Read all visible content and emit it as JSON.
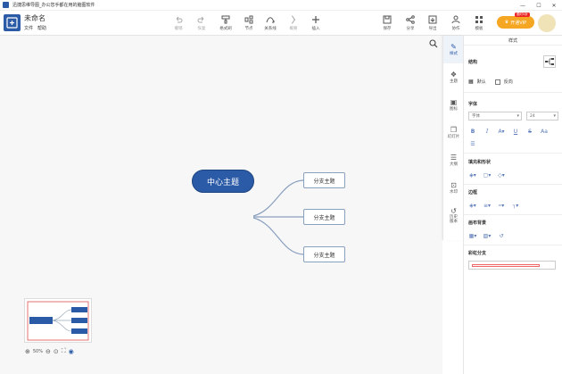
{
  "window": {
    "title": "迅捷思维导图_办公您手都在用的脑图软件",
    "controls": [
      "—",
      "☐",
      "✕"
    ]
  },
  "document": {
    "name": "未命名",
    "menu": [
      "文件",
      "帮助"
    ]
  },
  "toolbar": {
    "undo": "撤销",
    "redo": "恢复",
    "format_painter": "格式刷",
    "node": "节点",
    "relation": "关系线",
    "summary": "概要",
    "insert": "插入",
    "save": "保存",
    "share": "分享",
    "export": "导出",
    "collab": "协作",
    "template": "模板",
    "vip_label": "开通VIP",
    "vip_badge": "限时5折"
  },
  "mindmap": {
    "center": "中心主题",
    "branches": [
      "分支主题",
      "分支主题",
      "分支主题"
    ]
  },
  "zoom": {
    "level": "50%"
  },
  "rail": [
    "样式",
    "主题",
    "图标",
    "幻灯片",
    "大纲",
    "水印",
    "历史版本"
  ],
  "panel": {
    "title": "样式",
    "structure": "结构",
    "default_label": "默认",
    "reverse_label": "反向",
    "font_section": "字体",
    "font_family": "字体",
    "font_size": "24",
    "fill_section": "填充和形状",
    "border_section": "边框",
    "canvas_section": "画布背景",
    "rainbow_section": "彩虹分支"
  },
  "colors": {
    "accent": "#2b5aa7",
    "vip": "#f5a623"
  }
}
